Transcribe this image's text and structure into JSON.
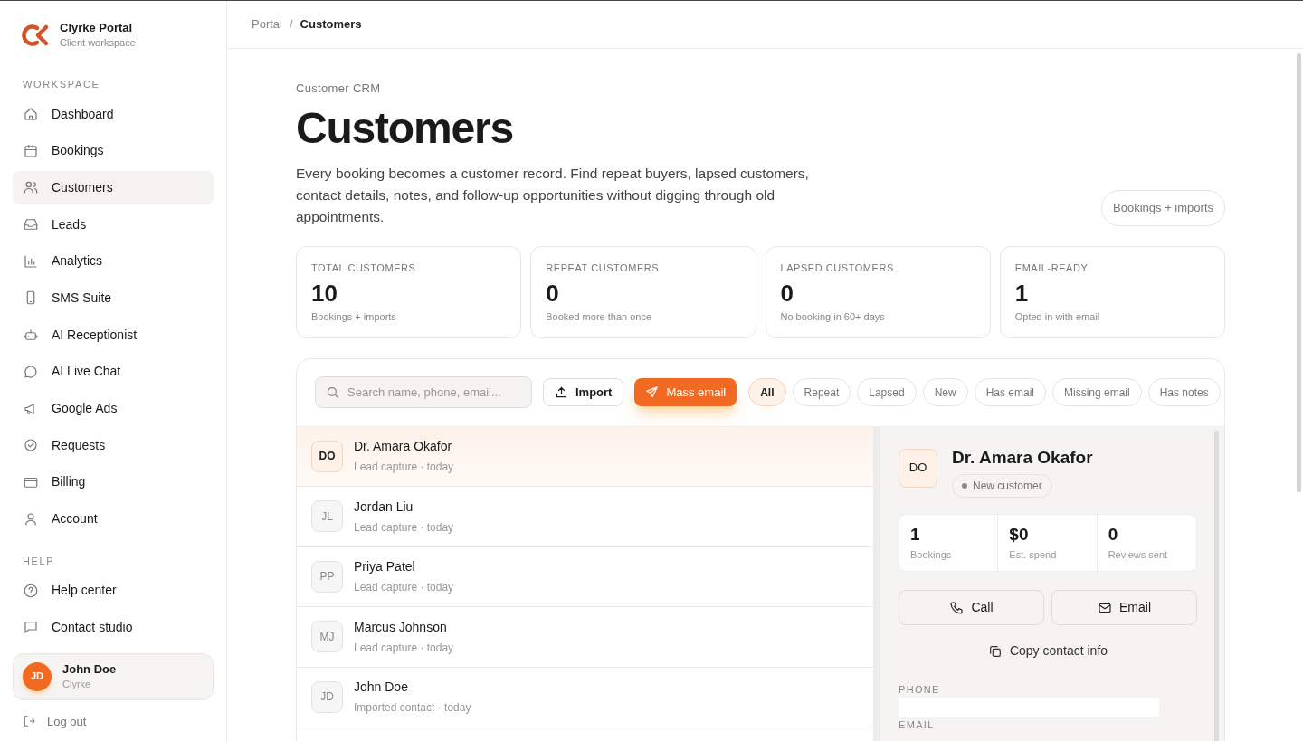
{
  "brand": {
    "name": "Clyrke Portal",
    "subtitle": "Client workspace"
  },
  "sidebar": {
    "sections": [
      {
        "heading": "WORKSPACE",
        "items": [
          {
            "label": "Dashboard",
            "selected": false
          },
          {
            "label": "Bookings",
            "selected": false
          },
          {
            "label": "Customers",
            "selected": true
          },
          {
            "label": "Leads",
            "selected": false
          },
          {
            "label": "Analytics",
            "selected": false
          },
          {
            "label": "SMS Suite",
            "selected": false
          },
          {
            "label": "AI Receptionist",
            "selected": false
          },
          {
            "label": "AI Live Chat",
            "selected": false
          },
          {
            "label": "Google Ads",
            "selected": false
          },
          {
            "label": "Requests",
            "selected": false
          },
          {
            "label": "Billing",
            "selected": false
          },
          {
            "label": "Account",
            "selected": false
          }
        ]
      },
      {
        "heading": "HELP",
        "items": [
          {
            "label": "Help center",
            "selected": false
          },
          {
            "label": "Contact studio",
            "selected": false
          }
        ]
      }
    ],
    "user": {
      "initials": "JD",
      "name": "John Doe",
      "org": "Clyrke"
    },
    "logout": "Log out"
  },
  "breadcrumb": {
    "items": [
      "Portal",
      "Customers"
    ],
    "separator": "/"
  },
  "header": {
    "eyebrow": "Customer CRM",
    "title": "Customers",
    "description": "Every booking becomes a customer record. Find repeat buyers, lapsed customers, contact details, notes, and follow-up opportunities without digging through old appointments.",
    "badge": "Bookings + imports"
  },
  "stats": [
    {
      "label": "TOTAL CUSTOMERS",
      "value": "10",
      "note": "Bookings + imports"
    },
    {
      "label": "REPEAT CUSTOMERS",
      "value": "0",
      "note": "Booked more than once"
    },
    {
      "label": "LAPSED CUSTOMERS",
      "value": "0",
      "note": "No booking in 60+ days"
    },
    {
      "label": "EMAIL-READY",
      "value": "1",
      "note": "Opted in with email"
    }
  ],
  "toolbar": {
    "search": {
      "placeholder": "Search name, phone, email..."
    },
    "import": "Import",
    "mass_email": "Mass email",
    "filters": [
      {
        "label": "All",
        "selected": true
      },
      {
        "label": "Repeat",
        "selected": false
      },
      {
        "label": "Lapsed",
        "selected": false
      },
      {
        "label": "New",
        "selected": false
      },
      {
        "label": "Has email",
        "selected": false
      },
      {
        "label": "Missing email",
        "selected": false
      },
      {
        "label": "Has notes",
        "selected": false
      }
    ]
  },
  "customers": [
    {
      "initials": "DO",
      "name": "Dr. Amara Okafor",
      "source": "Lead capture · today",
      "selected": true
    },
    {
      "initials": "JL",
      "name": "Jordan Liu",
      "source": "Lead capture · today",
      "selected": false
    },
    {
      "initials": "PP",
      "name": "Priya Patel",
      "source": "Lead capture · today",
      "selected": false
    },
    {
      "initials": "MJ",
      "name": "Marcus Johnson",
      "source": "Lead capture · today",
      "selected": false
    },
    {
      "initials": "JD",
      "name": "John Doe",
      "source": "Imported contact · today",
      "selected": false
    }
  ],
  "detail": {
    "initials": "DO",
    "name": "Dr. Amara Okafor",
    "status": "New customer",
    "metrics": [
      {
        "value": "1",
        "label": "Bookings"
      },
      {
        "value": "$0",
        "label": "Est. spend"
      },
      {
        "value": "0",
        "label": "Reviews sent"
      }
    ],
    "call": "Call",
    "email": "Email",
    "copy": "Copy contact info",
    "fields": [
      {
        "label": "PHONE"
      },
      {
        "label": "EMAIL"
      }
    ]
  }
}
